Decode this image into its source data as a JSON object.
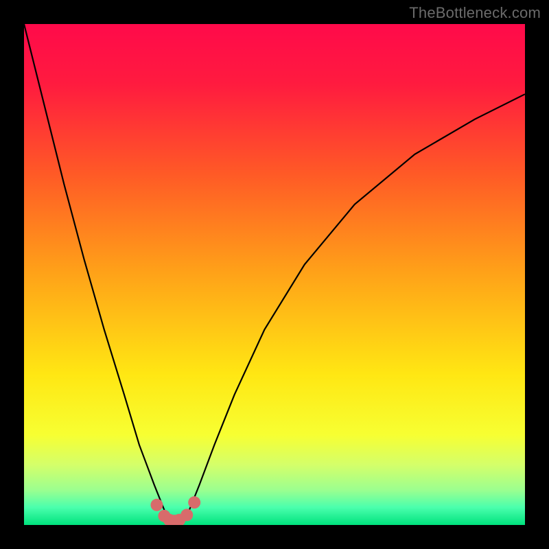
{
  "watermark": "TheBottleneck.com",
  "colors": {
    "frame": "#000000",
    "gradient_stops": [
      {
        "offset": 0.0,
        "color": "#ff0a4a"
      },
      {
        "offset": 0.12,
        "color": "#ff1b3f"
      },
      {
        "offset": 0.3,
        "color": "#ff5a26"
      },
      {
        "offset": 0.5,
        "color": "#ffa318"
      },
      {
        "offset": 0.7,
        "color": "#ffe713"
      },
      {
        "offset": 0.82,
        "color": "#f7ff32"
      },
      {
        "offset": 0.88,
        "color": "#d4ff6a"
      },
      {
        "offset": 0.93,
        "color": "#9cff8f"
      },
      {
        "offset": 0.965,
        "color": "#4affad"
      },
      {
        "offset": 1.0,
        "color": "#00e27d"
      }
    ],
    "curve": "#000000",
    "marker": "#d86b6b"
  },
  "chart_data": {
    "type": "line",
    "title": "",
    "xlabel": "",
    "ylabel": "",
    "xlim": [
      0,
      100
    ],
    "ylim": [
      0,
      100
    ],
    "grid": false,
    "legend": false,
    "series": [
      {
        "name": "bottleneck-curve",
        "x": [
          0,
          4,
          8,
          12,
          16,
          20,
          23,
          26,
          28,
          29.5,
          31,
          33,
          35,
          38,
          42,
          48,
          56,
          66,
          78,
          90,
          100
        ],
        "y": [
          100,
          84,
          68,
          53,
          39,
          26,
          16,
          8,
          3,
          1,
          1,
          3,
          8,
          16,
          26,
          39,
          52,
          64,
          74,
          81,
          86
        ]
      }
    ],
    "markers": {
      "name": "bottom-cluster",
      "x": [
        26.5,
        28.0,
        29.0,
        30.0,
        31.0,
        32.5,
        34.0
      ],
      "y": [
        4.0,
        1.8,
        1.0,
        0.8,
        1.0,
        2.0,
        4.5
      ]
    }
  }
}
